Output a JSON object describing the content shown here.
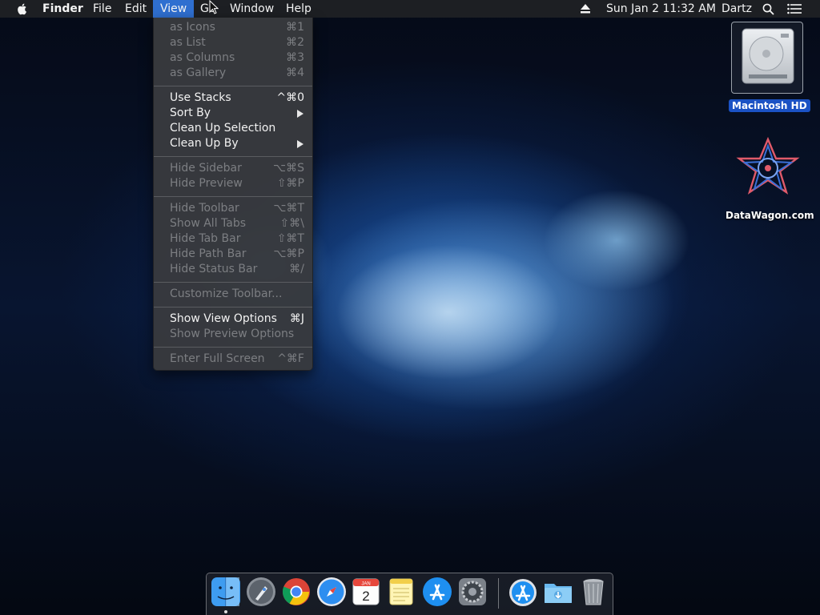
{
  "menubar": {
    "apple_icon": "apple-logo-icon",
    "app_name": "Finder",
    "menus": [
      "File",
      "Edit",
      "View",
      "Go",
      "Window",
      "Help"
    ],
    "active_menu": "View",
    "eject_icon": "eject-icon",
    "clock": "Sun Jan 2  11:32 AM",
    "user": "Dartz",
    "spotlight_icon": "spotlight-search-icon",
    "notification_icon": "notification-center-icon"
  },
  "view_menu": {
    "items": [
      {
        "label": "as Icons",
        "shortcut": "⌘1",
        "enabled": false
      },
      {
        "label": "as List",
        "shortcut": "⌘2",
        "enabled": false
      },
      {
        "label": "as Columns",
        "shortcut": "⌘3",
        "enabled": false
      },
      {
        "label": "as Gallery",
        "shortcut": "⌘4",
        "enabled": false
      },
      {
        "label": "Use Stacks",
        "shortcut": "^⌘0",
        "enabled": true
      },
      {
        "label": "Sort By",
        "shortcut": "",
        "enabled": true,
        "submenu": true
      },
      {
        "label": "Clean Up Selection",
        "shortcut": "",
        "enabled": true
      },
      {
        "label": "Clean Up By",
        "shortcut": "",
        "enabled": true,
        "submenu": true
      },
      {
        "label": "Hide Sidebar",
        "shortcut": "⌥⌘S",
        "enabled": false
      },
      {
        "label": "Hide Preview",
        "shortcut": "⇧⌘P",
        "enabled": false
      },
      {
        "label": "Hide Toolbar",
        "shortcut": "⌥⌘T",
        "enabled": false
      },
      {
        "label": "Show All Tabs",
        "shortcut": "⇧⌘\\",
        "enabled": false
      },
      {
        "label": "Hide Tab Bar",
        "shortcut": "⇧⌘T",
        "enabled": false
      },
      {
        "label": "Hide Path Bar",
        "shortcut": "⌥⌘P",
        "enabled": false
      },
      {
        "label": "Hide Status Bar",
        "shortcut": "⌘/",
        "enabled": false
      },
      {
        "label": "Customize Toolbar...",
        "shortcut": "",
        "enabled": false
      },
      {
        "label": "Show View Options",
        "shortcut": "⌘J",
        "enabled": true
      },
      {
        "label": "Show Preview Options",
        "shortcut": "",
        "enabled": false
      },
      {
        "label": "Enter Full Screen",
        "shortcut": "^⌘F",
        "enabled": false
      }
    ]
  },
  "desktop": {
    "drive_label": "Macintosh HD",
    "drive_icon": "hard-drive-icon",
    "bookmark_label": "DataWagon.com",
    "bookmark_icon": "datawagon-logo-icon"
  },
  "dock": {
    "apps": [
      {
        "name": "Finder",
        "icon": "finder-icon"
      },
      {
        "name": "Launchpad",
        "icon": "launchpad-icon"
      },
      {
        "name": "Google Chrome",
        "icon": "chrome-icon"
      },
      {
        "name": "Safari",
        "icon": "safari-icon"
      },
      {
        "name": "Calendar",
        "icon": "calendar-icon",
        "badge_month": "JAN",
        "badge_day": "2"
      },
      {
        "name": "Notes",
        "icon": "notes-icon"
      },
      {
        "name": "App Store",
        "icon": "app-store-icon"
      },
      {
        "name": "System Preferences",
        "icon": "system-preferences-icon"
      },
      {
        "name": "Applications",
        "icon": "applications-folder-icon"
      },
      {
        "name": "Downloads",
        "icon": "downloads-folder-icon"
      },
      {
        "name": "Trash",
        "icon": "trash-icon"
      }
    ]
  },
  "colors": {
    "menu_highlight": "#2f6fd0",
    "menubar_bg": "#1d1f23",
    "menu_bg": "#383a3e",
    "label_selected_bg": "#1b52c4"
  }
}
